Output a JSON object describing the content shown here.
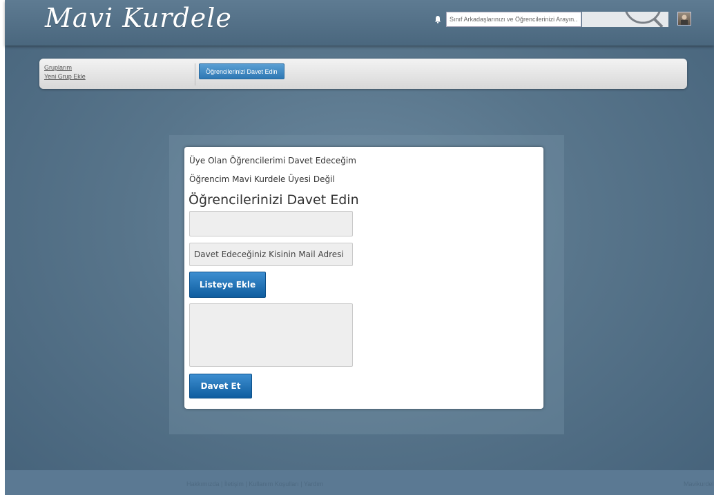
{
  "header": {
    "logo": "Mavi Kurdele",
    "search_placeholder": "Sınıf Arkadaşlarınızı ve Öğrencilerinizi Arayın...",
    "notification_icon": "notification-icon",
    "search_icon": "search-icon"
  },
  "nav": {
    "links": [
      "Gruplarım",
      "Yeni Grup Ekle"
    ],
    "invite_button": "Öğrencilerinizi Davet Edin"
  },
  "card": {
    "option_member": "Üye Olan Öğrencilerimi Davet Edeceğim",
    "option_nonmember": "Öğrencim Mavi Kurdele Üyesi Değil",
    "title": "Öğrencilerinizi Davet Edin",
    "name_field_value": "",
    "email_placeholder": "Davet Edeceğiniz Kisinin Mail Adresi",
    "add_button": "Listeye Ekle",
    "list_value": "",
    "invite_button": "Davet Et"
  },
  "footer": {
    "links": "Hakkımızda | İletişim | Kullanım Koşulları | Yardım",
    "right": "Mavikurdele"
  },
  "colors": {
    "background": "#4f6d84",
    "header": "#56738a",
    "accent_blue": "#1f6fb2",
    "card": "#ffffff"
  }
}
